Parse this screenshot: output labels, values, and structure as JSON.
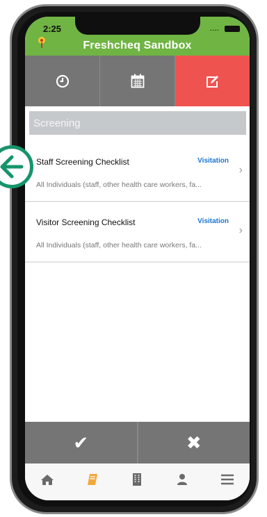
{
  "status_bar": {
    "time": "2:25",
    "signal": "....",
    "battery": "battery-icon"
  },
  "header": {
    "title": "Freshcheq Sandbox",
    "logo_icon": "app-logo-icon"
  },
  "tabs": [
    {
      "icon": "clock-icon",
      "active": false
    },
    {
      "icon": "calendar-icon",
      "active": false
    },
    {
      "icon": "edit-icon",
      "active": true
    }
  ],
  "section_title": "Screening",
  "items": [
    {
      "title": "Staff Screening Checklist",
      "tag": "Visitation",
      "subtitle": "All Individuals (staff, other health care workers, fa..."
    },
    {
      "title": "Visitor Screening Checklist",
      "tag": "Visitation",
      "subtitle": "All Individuals (staff, other health care workers, fa..."
    }
  ],
  "actions": {
    "confirm_label": "✔",
    "cancel_label": "✖"
  },
  "bottom_nav": [
    {
      "icon": "home-icon"
    },
    {
      "icon": "book-icon"
    },
    {
      "icon": "building-icon"
    },
    {
      "icon": "user-icon"
    },
    {
      "icon": "menu-icon"
    }
  ],
  "colors": {
    "header_green": "#70b444",
    "active_tab_red": "#ef5350",
    "tab_gray": "#757575",
    "tag_blue": "#1976d2",
    "back_button_green": "#16946a",
    "nav_active_orange": "#f2a93b"
  }
}
